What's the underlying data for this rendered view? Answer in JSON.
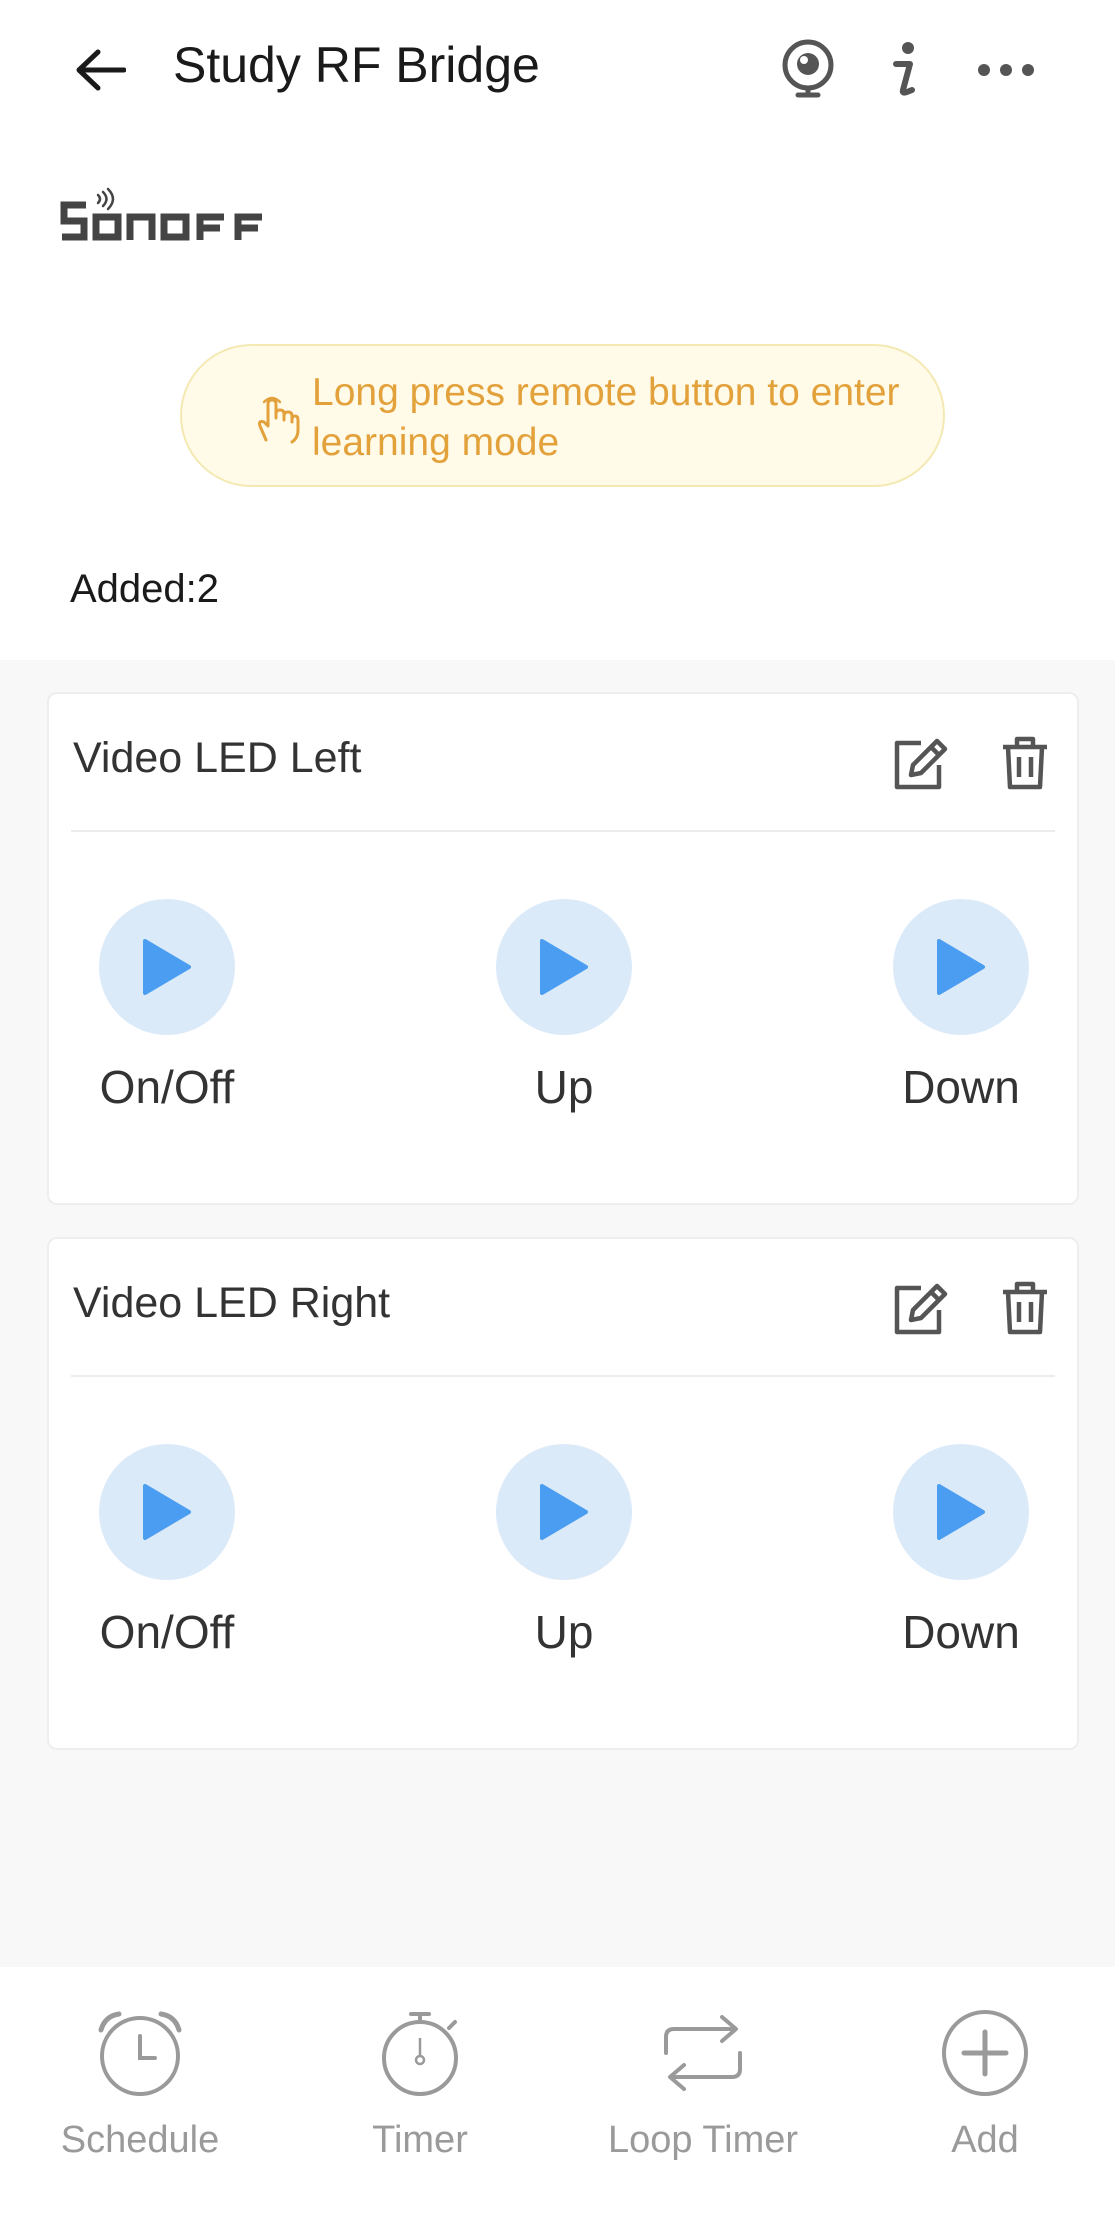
{
  "header": {
    "title": "Study RF Bridge"
  },
  "logo": {
    "text": "SONOFF"
  },
  "hint": {
    "text": "Long press remote button to enter learning mode"
  },
  "added": {
    "text": "Added:2"
  },
  "remotes": [
    {
      "name": "Video LED Left",
      "buttons": [
        "On/Off",
        "Up",
        "Down"
      ]
    },
    {
      "name": "Video LED Right",
      "buttons": [
        "On/Off",
        "Up",
        "Down"
      ]
    }
  ],
  "tabs": [
    "Schedule",
    "Timer",
    "Loop Timer",
    "Add"
  ],
  "colors": {
    "accent_blue": "#4a9df0",
    "button_bg": "#dbeaf9",
    "hint_text": "#e3a13b",
    "hint_bg": "#fffbe8",
    "tab_gray": "#9a9a9a"
  }
}
